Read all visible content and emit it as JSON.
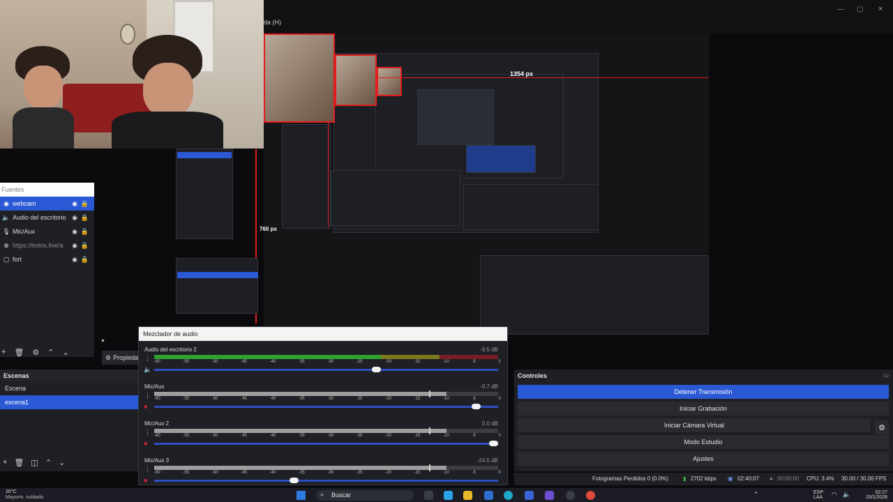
{
  "window": {
    "title_fragment": "da (H)",
    "controls": [
      "—",
      "▢",
      "✕"
    ]
  },
  "preview": {
    "width_label": "1354 px",
    "height_label": "760 px"
  },
  "sources": {
    "title": "Fuentes",
    "items": [
      {
        "label": "webcam",
        "icon": "camera-icon",
        "glyph": "◉",
        "selected": true,
        "dim": false
      },
      {
        "label": "Audio del escritorio",
        "icon": "speaker-icon",
        "glyph": "🔈",
        "selected": false,
        "dim": false
      },
      {
        "label": "Mic/Aux",
        "icon": "microphone-icon",
        "glyph": "🎙",
        "selected": false,
        "dim": false
      },
      {
        "label": "https://botrix.live/a",
        "icon": "globe-icon",
        "glyph": "⊕",
        "selected": false,
        "dim": true
      },
      {
        "label": "fort",
        "icon": "display-icon",
        "glyph": "▢",
        "selected": false,
        "dim": false
      }
    ],
    "toolbar": [
      "+",
      "🗑",
      "⚙",
      "⌃",
      "⌄"
    ]
  },
  "properties_button": "Propieda",
  "scenes": {
    "title": "Escenas",
    "items": [
      {
        "label": "Escena",
        "selected": false
      },
      {
        "label": "escena1",
        "selected": true
      }
    ],
    "toolbar": [
      "+",
      "🗑",
      "◫",
      "⌃",
      "⌄"
    ]
  },
  "mixer": {
    "title": "Mezclador de audio",
    "ticks": [
      "-60",
      "-55",
      "-50",
      "-45",
      "-40",
      "-35",
      "-30",
      "-25",
      "-20",
      "-15",
      "-10",
      "-5",
      "0"
    ],
    "channels": [
      {
        "name": "Audio del escritorio 2",
        "db": "-9.5 dB",
        "level": 0.8,
        "active": true,
        "fader": 0.66,
        "muted": false
      },
      {
        "name": "Mic/Aux",
        "db": "-0.7 dB",
        "level": 0.85,
        "active": false,
        "fader": 0.95,
        "muted": true
      },
      {
        "name": "Mic/Aux 2",
        "db": "0.0 dB",
        "level": 0.85,
        "active": false,
        "fader": 1.0,
        "muted": true
      },
      {
        "name": "Mic/Aux 3",
        "db": "-24.5 dB",
        "level": 0.85,
        "active": false,
        "fader": 0.42,
        "muted": true
      }
    ]
  },
  "controls": {
    "title": "Controles",
    "buttons": [
      {
        "label": "Detener Transmisión",
        "primary": true
      },
      {
        "label": "Iniciar Grabación",
        "primary": false
      },
      {
        "label": "Iniciar Cámara Virtual",
        "primary": false
      },
      {
        "label": "Modo Estudio",
        "primary": false
      },
      {
        "label": "Ajustes",
        "primary": false
      }
    ]
  },
  "status": {
    "dropped": "Fotogramas Perdidos 0 (0.0%)",
    "bitrate": "2702 kbps",
    "stream_time": "02:40:07",
    "rec_time": "00:00:00",
    "cpu": "CPU: 3.4%",
    "fps": "30.00 / 30.00 FPS"
  },
  "taskbar": {
    "temp": "20°C",
    "weather": "Mayorm. nublado",
    "search": "Buscar",
    "lang": "ESP",
    "lang_sub": "LAA",
    "time": "02:27",
    "date": "15/1/2026"
  }
}
